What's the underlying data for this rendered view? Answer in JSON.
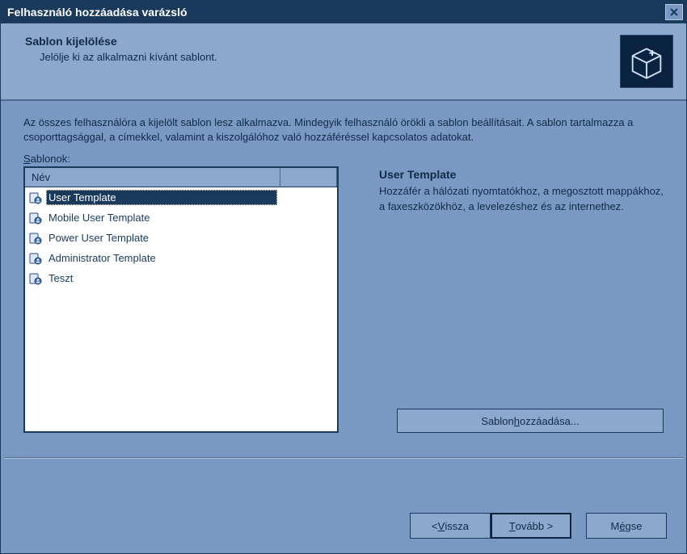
{
  "window": {
    "title": "Felhasználó hozzáadása varázsló"
  },
  "header": {
    "title": "Sablon kijelölése",
    "subtitle": "Jelölje ki az alkalmazni kívánt sablont."
  },
  "instructions": "Az összes felhasználóra a kijelölt sablon lesz alkalmazva. Mindegyik felhasználó örökli a sablon beállításait. A sablon tartalmazza a csoporttagsággal, a címekkel, valamint a kiszolgálóhoz való hozzáféréssel kapcsolatos adatokat.",
  "sablonok_label_pre": "S",
  "sablonok_label_post": "ablonok:",
  "list": {
    "header_name": "Név",
    "items": [
      {
        "label": "User Template",
        "selected": true
      },
      {
        "label": "Mobile User Template",
        "selected": false
      },
      {
        "label": "Power User Template",
        "selected": false
      },
      {
        "label": "Administrator Template",
        "selected": false
      },
      {
        "label": "Teszt",
        "selected": false
      }
    ]
  },
  "details": {
    "title": "User Template",
    "desc": "Hozzáfér a hálózati nyomtatókhoz, a megosztott mappákhoz, a faxeszközökhöz, a levelezéshez és az internethez."
  },
  "add_template_pre": "Sablon ",
  "add_template_u": "h",
  "add_template_post": "ozzáadása...",
  "buttons": {
    "back_lt": "< ",
    "back_u": "V",
    "back_post": "issza",
    "next_u": "T",
    "next_post": "ovább >",
    "cancel_pre": "M",
    "cancel_u": "é",
    "cancel_post": "gse"
  }
}
